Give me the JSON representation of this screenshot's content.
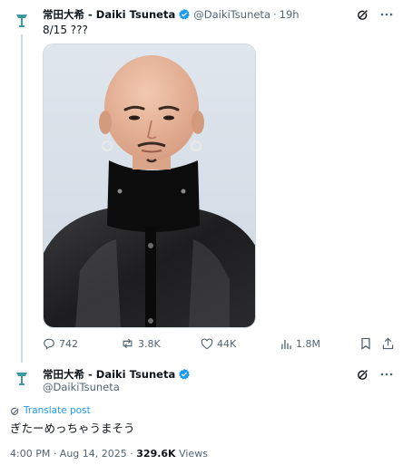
{
  "tweet1": {
    "display_name": "常田大希 - Daiki Tsuneta",
    "handle": "@DaikiTsuneta",
    "separator": "·",
    "time": "19h",
    "text": "8/15 ???",
    "icons": [
      "grok-icon",
      "more-icon",
      "verified-icon",
      "avatar-logo-icon"
    ]
  },
  "engagement": {
    "replies": "742",
    "reposts": "3.8K",
    "likes": "44K",
    "views": "1.8M",
    "icons": [
      "reply-icon",
      "repost-icon",
      "like-icon",
      "views-icon",
      "bookmark-icon",
      "share-icon"
    ]
  },
  "tweet2": {
    "display_name": "常田大希 - Daiki Tsuneta",
    "handle": "@DaikiTsuneta",
    "translate_label": "Translate post",
    "text": "ぎたーめっちゃうまそう",
    "timestamp": "4:00 PM · Aug 14, 2025 ·",
    "views_count": "329.6K",
    "views_label": "Views"
  },
  "colors": {
    "accent": "#1d9bf0",
    "text": "#0f1419",
    "muted": "#536471",
    "avatar_bg": "#2f8c8c"
  }
}
